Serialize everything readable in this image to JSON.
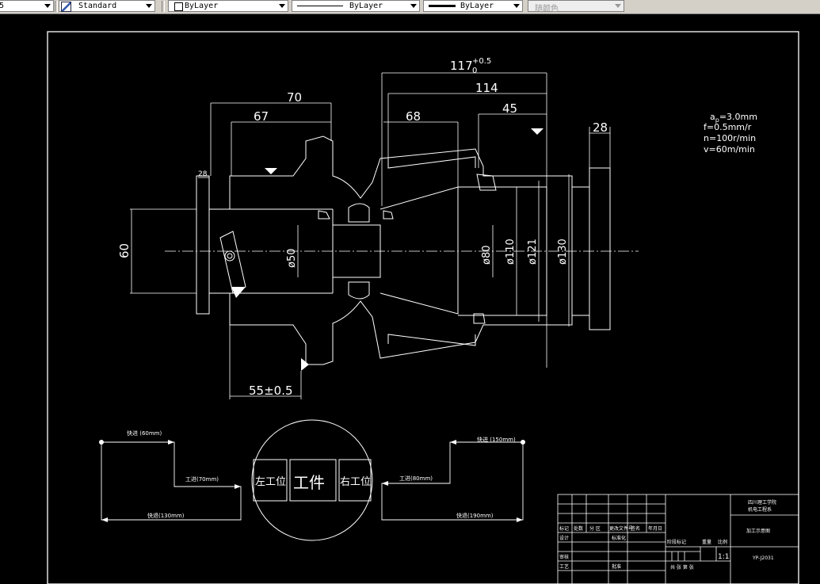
{
  "toolbar": {
    "dim_scale": "5",
    "text_style": "Standard",
    "layer": "ByLayer",
    "linetype": "ByLayer",
    "lineweight": "ByLayer",
    "color": "随颜色"
  },
  "dims": {
    "d117_base": "117",
    "d117_sup": "+0.5",
    "d117_sub": "0",
    "d114": "114",
    "d70": "70",
    "d67": "67",
    "d68": "68",
    "d45": "45",
    "d28_top": "28",
    "d28_left": "28",
    "d60": "60",
    "d50": "ø50",
    "d80": "ø80",
    "d110": "ø110",
    "d121": "ø121",
    "d130": "ø130",
    "d55": "55±0.5"
  },
  "params": {
    "ap_a": "a",
    "ap_sub": "p",
    "ap_rest": "=3.0mm",
    "f": "f=0.5mm/r",
    "n": "n=100r/min",
    "v": "v=60m/min"
  },
  "motion_left": {
    "fast1": "快进 (60mm)",
    "work": "工进(70mm)",
    "fast2": "快退(130mm)"
  },
  "motion_right": {
    "fast1": "快进 (150mm)",
    "work": "工进(80mm)",
    "fast2": "快退(190mm)"
  },
  "station": {
    "left": "左工位",
    "center": "工件",
    "right": "右工位"
  },
  "title_block": {
    "school_1": "四川理工学院",
    "school_2": "机电工程系",
    "drawing_name": "加工示意图",
    "drawing_no": "YP-J2031",
    "scale": "1:1",
    "h_mark": "标记",
    "h_count": "处数",
    "h_zone": "分 区",
    "h_docno": "更改文件号",
    "h_sign": "签名",
    "h_date": "年月日",
    "design": "设计",
    "standard": "标准化",
    "stage": "阶段标记",
    "weight": "重量",
    "ratio": "比例",
    "review": "审核",
    "craft": "工艺",
    "approve": "批准",
    "sheets": "共 张 第 张"
  }
}
